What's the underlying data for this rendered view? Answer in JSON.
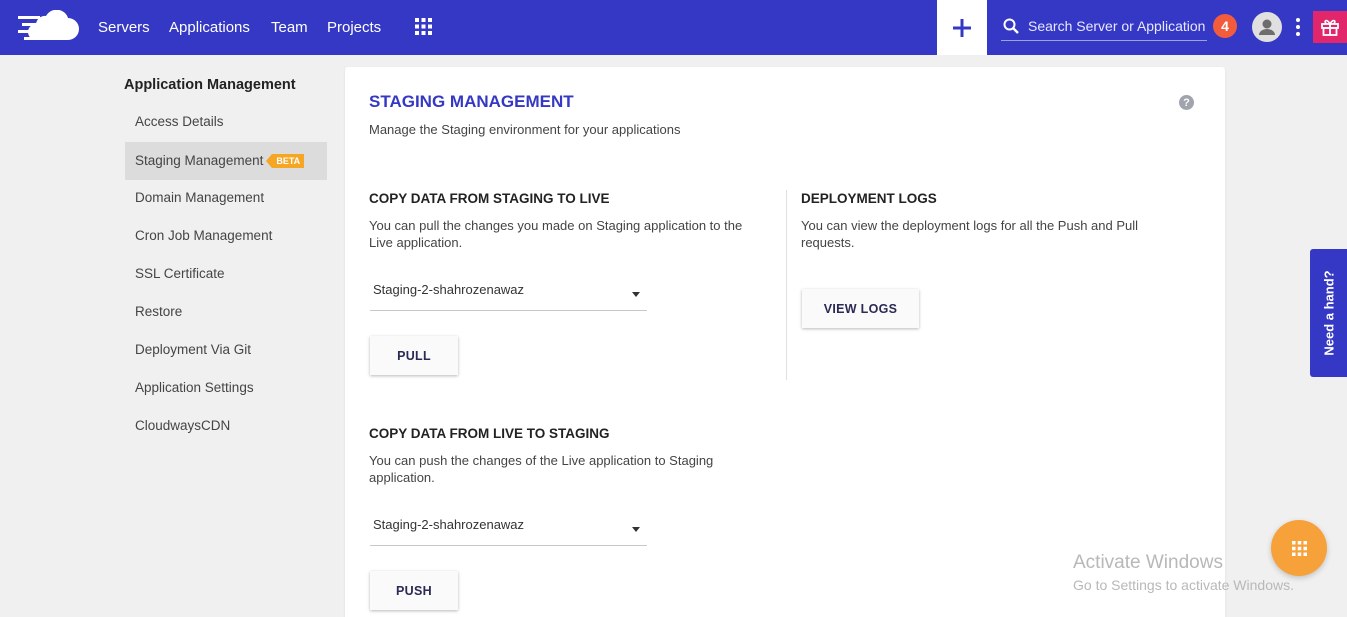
{
  "colors": {
    "brand": "#3438c4",
    "accent_orange": "#f5a623",
    "badge_red": "#f25c3c",
    "gift_pink": "#e2266c"
  },
  "topbar": {
    "logo_icon": "cloud-logo-icon",
    "nav": [
      "Servers",
      "Applications",
      "Team",
      "Projects"
    ],
    "apps_grid_icon": "grid-icon",
    "add_icon": "plus-icon",
    "search_placeholder": "Search Server or Application",
    "notification_count": "4",
    "avatar_icon": "user-avatar-icon",
    "menu_icon": "kebab-menu-icon",
    "gift_icon": "gift-icon"
  },
  "sidebar": {
    "title": "Application Management",
    "items": [
      {
        "label": "Access Details"
      },
      {
        "label": "Staging Management",
        "badge": "BETA",
        "active": true
      },
      {
        "label": "Domain Management"
      },
      {
        "label": "Cron Job Management"
      },
      {
        "label": "SSL Certificate"
      },
      {
        "label": "Restore"
      },
      {
        "label": "Deployment Via Git"
      },
      {
        "label": "Application Settings"
      },
      {
        "label": "CloudwaysCDN"
      }
    ]
  },
  "main": {
    "title": "STAGING MANAGEMENT",
    "subtitle": "Manage the Staging environment for your applications",
    "help_icon": "?",
    "staging_to_live": {
      "title": "COPY DATA FROM STAGING TO LIVE",
      "desc_line1": "You can pull the changes you made on Staging application to the",
      "desc_line2": "Live application.",
      "selected": "Staging-2-shahrozenawaz",
      "button": "PULL"
    },
    "logs": {
      "title": "DEPLOYMENT LOGS",
      "desc_line1": "You can view the deployment logs for all the Push and Pull",
      "desc_line2": "requests.",
      "button": "VIEW LOGS"
    },
    "live_to_staging": {
      "title": "COPY DATA FROM LIVE TO STAGING",
      "desc_line1": "You can push the changes of the Live application to Staging",
      "desc_line2": "application.",
      "selected": "Staging-2-shahrozenawaz",
      "button": "PUSH"
    }
  },
  "need_hand": "Need a hand?",
  "watermark": {
    "line1": "Activate Windows",
    "line2": "Go to Settings to activate Windows."
  },
  "fab_icon": "grid-icon"
}
